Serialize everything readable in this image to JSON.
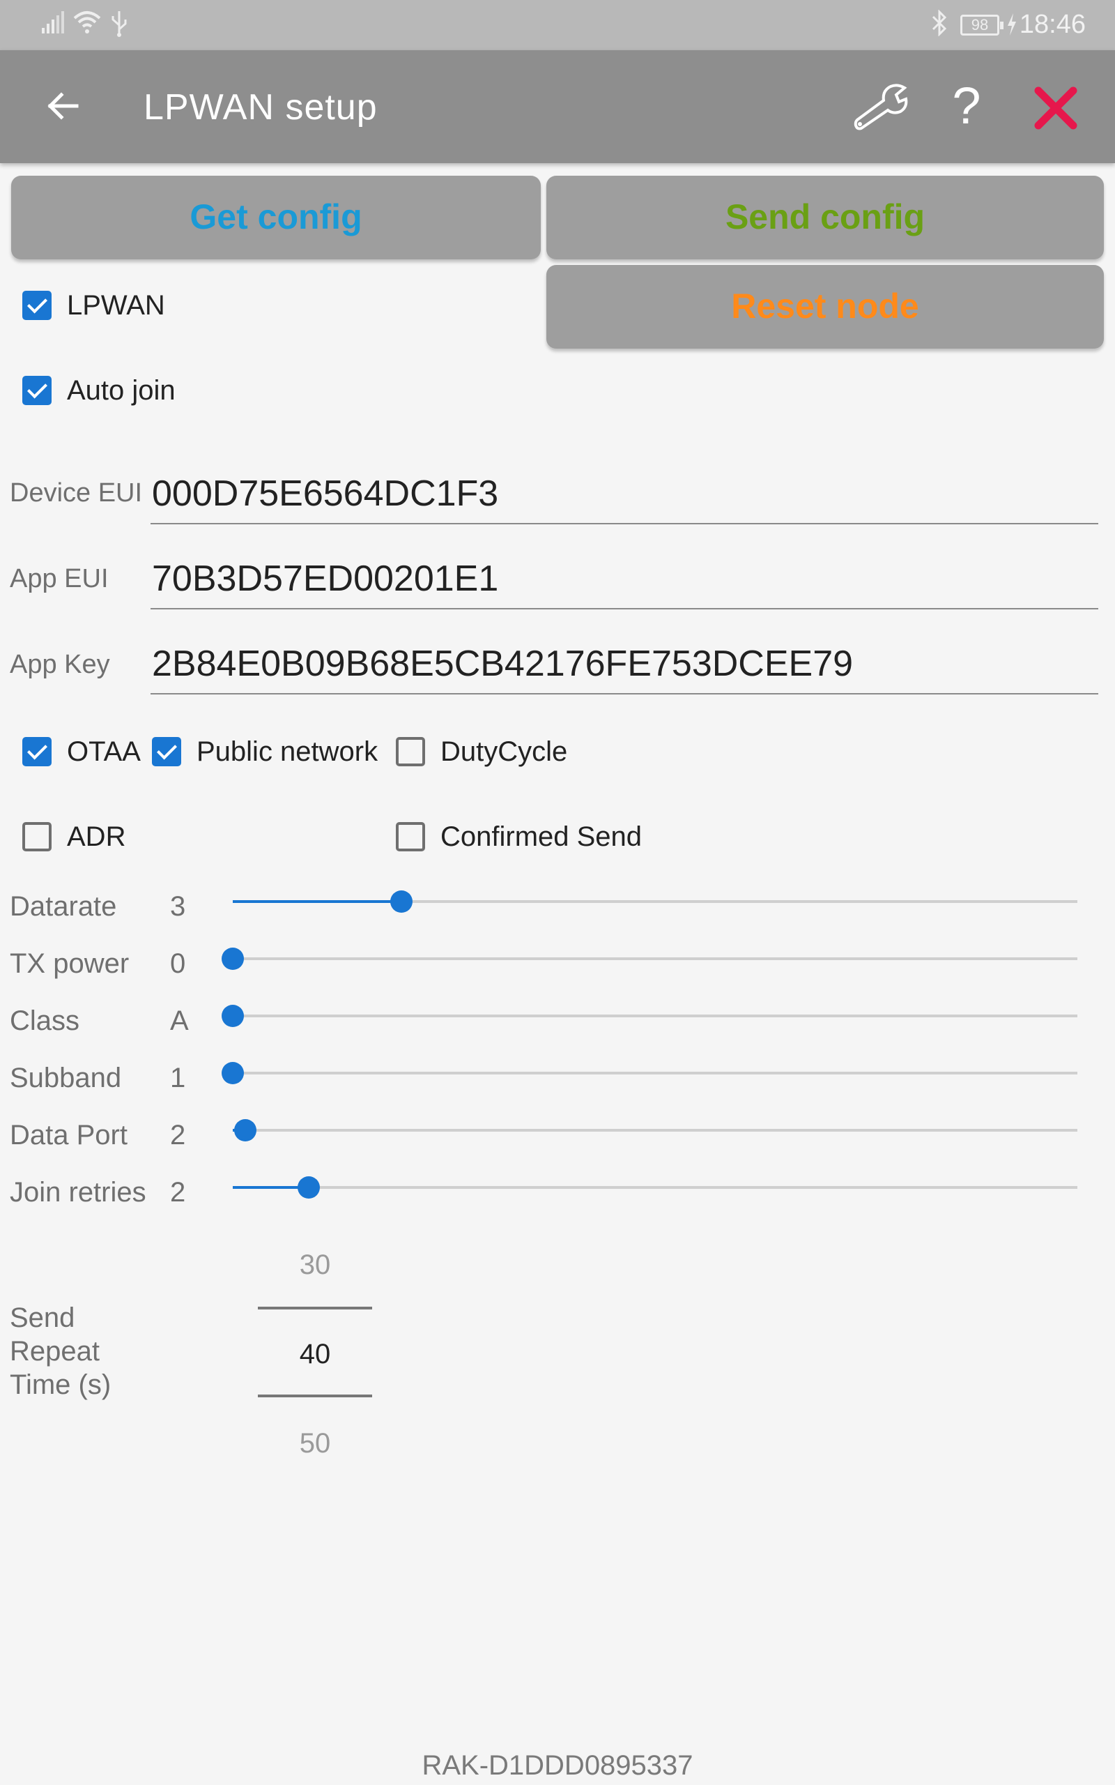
{
  "status_bar": {
    "signal_icon": "signal-icon",
    "wifi_icon": "wifi-icon",
    "usb_icon": "usb-icon",
    "bluetooth_icon": "bluetooth-icon",
    "battery": "98",
    "time": "18:46"
  },
  "app_bar": {
    "back_icon": "arrow-left-icon",
    "title": "LPWAN setup",
    "wrench_icon": "wrench-icon",
    "help_icon": "question-icon",
    "close_icon": "close-icon",
    "accent_close": "#e6174c"
  },
  "buttons": {
    "get_config": "Get config",
    "send_config": "Send config",
    "reset_node": "Reset node"
  },
  "checkboxes": {
    "lpwan": {
      "label": "LPWAN",
      "checked": true
    },
    "auto_join": {
      "label": "Auto join",
      "checked": true
    },
    "otaa": {
      "label": "OTAA",
      "checked": true
    },
    "public_network": {
      "label": "Public network",
      "checked": true
    },
    "duty_cycle": {
      "label": "DutyCycle",
      "checked": false
    },
    "adr": {
      "label": "ADR",
      "checked": false
    },
    "confirmed_send": {
      "label": "Confirmed Send",
      "checked": false
    }
  },
  "fields": {
    "device_eui": {
      "label": "Device EUI",
      "value": "000D75E6564DC1F3"
    },
    "app_eui": {
      "label": "App EUI",
      "value": "70B3D57ED00201E1"
    },
    "app_key": {
      "label": "App Key",
      "value": "2B84E0B09B68E5CB42176FE753DCEE79"
    }
  },
  "sliders": [
    {
      "label": "Datarate",
      "value": "3",
      "fraction": 0.2
    },
    {
      "label": "TX power",
      "value": "0",
      "fraction": 0.0
    },
    {
      "label": "Class",
      "value": "A",
      "fraction": 0.0
    },
    {
      "label": "Subband",
      "value": "1",
      "fraction": 0.0
    },
    {
      "label": "Data Port",
      "value": "2",
      "fraction": 0.015
    },
    {
      "label": "Join retries",
      "value": "2",
      "fraction": 0.09
    }
  ],
  "send_repeat": {
    "label": "Send\nRepeat\nTime (s)",
    "prev": "30",
    "current": "40",
    "next": "50"
  },
  "footer": {
    "device_id": "RAK-D1DDD0895337"
  },
  "colors": {
    "accent": "#1976d2",
    "get_config": "#1a9ad6",
    "send_config": "#6aa014",
    "reset_node": "#ff8a1a"
  }
}
